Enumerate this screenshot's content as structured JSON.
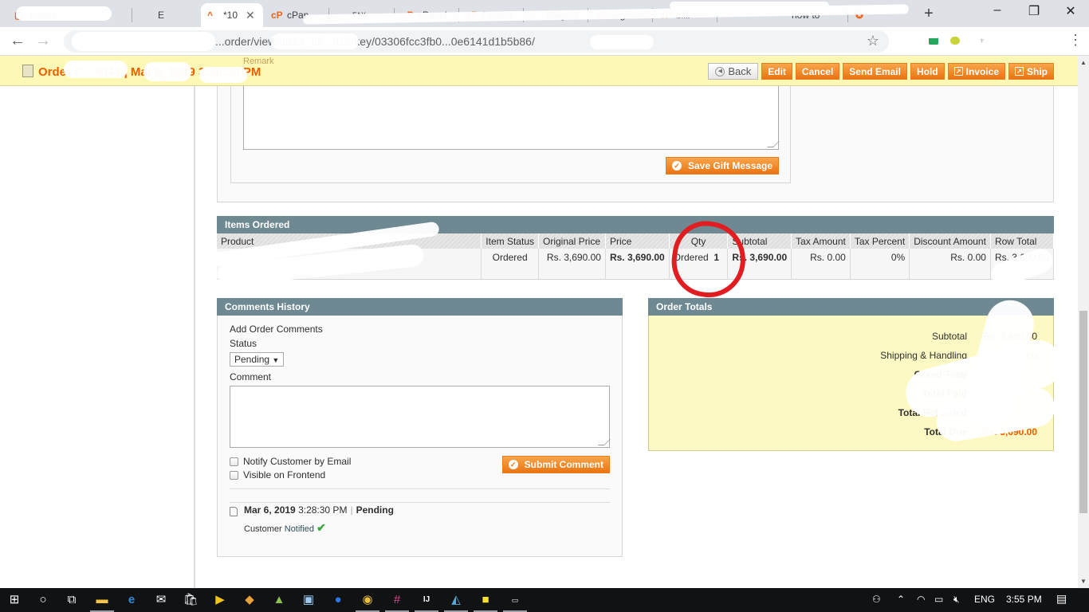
{
  "browser": {
    "tabs": [
      {
        "label": "create",
        "favicon": "page-icon"
      },
      {
        "label": "E",
        "favicon": "page-icon"
      },
      {
        "label": "*10",
        "favicon": "magento-icon",
        "active": true
      },
      {
        "label": "cPan",
        "favicon": "cpanel-icon"
      },
      {
        "label": "FAX",
        "favicon": "page-icon"
      },
      {
        "label": "cPanel",
        "favicon": "cpanel-icon"
      },
      {
        "label": "Default",
        "favicon": "cpanel-icon"
      },
      {
        "label": "Magent",
        "favicon": "magento-icon"
      },
      {
        "label": "register",
        "favicon": "cpanel-icon"
      },
      {
        "label": "billi",
        "favicon": "cpanel-icon"
      },
      {
        "label": "how to",
        "favicon": "page-icon"
      },
      {
        "label": "",
        "favicon": "shield-icon"
      }
    ],
    "new_tab": "+",
    "window_controls": {
      "minimize": "–",
      "restore": "❐",
      "close": "✕"
    },
    "nav": {
      "back": "←",
      "forward": "→"
    },
    "url": "...order/view/order_id/...012/key/03306fcc3fb0...0e6141d1b5b86/",
    "star": "☆",
    "menu": "⋮"
  },
  "header": {
    "order_title": "Order # ...9041 | Mar 6, 2019 3:28:30 PM",
    "remark": "Remark",
    "buttons": {
      "back": "Back",
      "edit": "Edit",
      "cancel": "Cancel",
      "send_email": "Send Email",
      "hold": "Hold",
      "invoice": "Invoice",
      "ship": "Ship"
    }
  },
  "gift_message": {
    "save_label": "Save Gift Message"
  },
  "items_ordered": {
    "title": "Items Ordered",
    "columns": [
      "Product",
      "Item Status",
      "Original Price",
      "Price",
      "Qty",
      "Subtotal",
      "Tax Amount",
      "Tax Percent",
      "Discount Amount",
      "Row Total"
    ],
    "rows": [
      {
        "product": "",
        "item_status": "Ordered",
        "original_price": "Rs. 3,690.00",
        "price": "Rs. 3,690.00",
        "qty_label": "Ordered",
        "qty_value": "1",
        "subtotal": "Rs. 3,690.00",
        "tax_amount": "Rs. 0.00",
        "tax_percent": "0%",
        "discount_amount": "Rs. 0.00",
        "row_total": "Rs. 3,690.00"
      }
    ]
  },
  "comments": {
    "title": "Comments History",
    "add_label": "Add Order Comments",
    "status_label": "Status",
    "status_value": "Pending",
    "comment_label": "Comment",
    "comment_value": "",
    "notify_label": "Notify Customer by Email",
    "visible_label": "Visible on Frontend",
    "submit_label": "Submit Comment",
    "history": [
      {
        "date": "Mar 6, 2019",
        "time": "3:28:30 PM",
        "status": "Pending",
        "customer_label": "Customer",
        "notified_label": "Notified"
      }
    ]
  },
  "totals": {
    "title": "Order Totals",
    "rows": [
      {
        "label": "Subtotal",
        "value": "Rs. 3,690.00"
      },
      {
        "label": "Shipping & Handling",
        "value": "Rs. 0.00"
      },
      {
        "label": "Grand Total",
        "value": ""
      },
      {
        "label": "Total Paid",
        "value": ""
      },
      {
        "label": "Total Refunded",
        "value": ""
      },
      {
        "label": "Total Due",
        "value": "Rs. 3,690.00"
      }
    ],
    "accent": "#eb5e00"
  },
  "taskbar": {
    "apps": [
      "start",
      "cortana",
      "task-view",
      "file-explorer",
      "edge",
      "mail",
      "store",
      "media-player",
      "git",
      "android-studio",
      "virtualbox",
      "firefox",
      "chrome",
      "slack",
      "intellij",
      "mysql-workbench",
      "sticky-notes",
      "terminal"
    ],
    "language": "ENG",
    "time": "3:55 PM"
  },
  "colors": {
    "header_bg": "#fdf8b5",
    "button_orange": "#ea7412",
    "section_head": "#6f8992",
    "totals_bg": "#fdf9c4",
    "annotation_red": "#e11d21"
  }
}
